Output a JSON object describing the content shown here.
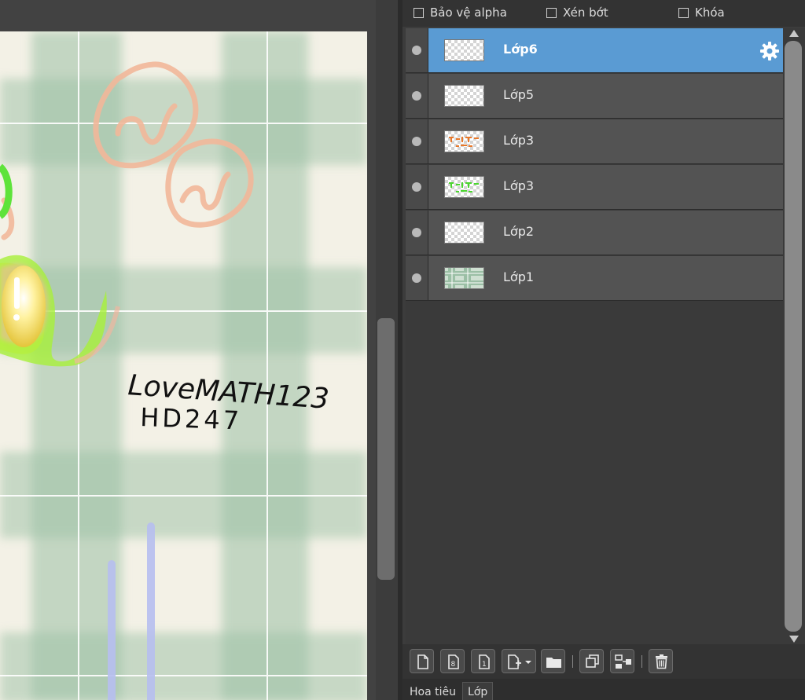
{
  "layer_options": {
    "protect_alpha": "Bảo vệ alpha",
    "clipping": "Xén bớt",
    "lock": "Khóa"
  },
  "layers": [
    {
      "name": "Lớp6",
      "selected": true,
      "thumb": "transparent"
    },
    {
      "name": "Lớp5",
      "selected": false,
      "thumb": "transparent"
    },
    {
      "name": "Lớp3",
      "selected": false,
      "thumb": "orange-text"
    },
    {
      "name": "Lớp3",
      "selected": false,
      "thumb": "green-text"
    },
    {
      "name": "Lớp2",
      "selected": false,
      "thumb": "transparent"
    },
    {
      "name": "Lớp1",
      "selected": false,
      "thumb": "green-plaid"
    }
  ],
  "canvas": {
    "handwriting_line1": "LoveMATH123",
    "handwriting_line2": "HD247"
  },
  "bottom_tabs": {
    "tab1": "Hoa tiêu",
    "tab2": "Lớp"
  },
  "colors": {
    "selected_row": "#5a9bd3",
    "plaid_green": "#a8c8b0",
    "paper": "#f3f1e6"
  }
}
